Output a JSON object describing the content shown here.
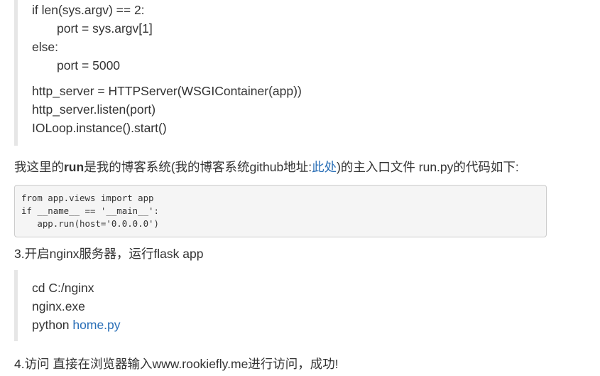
{
  "quote1": {
    "lines": [
      "if len(sys.argv) == 2:",
      "port = sys.argv[1]",
      "else:",
      "port = 5000",
      "http_server = HTTPServer(WSGIContainer(app))",
      "http_server.listen(port)",
      "IOLoop.instance().start()"
    ]
  },
  "para1": {
    "prefix": "我这里的",
    "bold": "run",
    "middle": "是我的博客系统(我的博客系统github地址:",
    "link": "此处",
    "suffix": ")的主入口文件 run.py的代码如下:"
  },
  "codeblock": {
    "lines": [
      "from app.views import app",
      "if __name__ == '__main__':",
      "   app.run(host='0.0.0.0')"
    ]
  },
  "step3": {
    "text": "3.开启nginx服务器，运行flask app"
  },
  "quote2": {
    "lines": [
      "cd C:/nginx",
      "nginx.exe"
    ],
    "python_prefix": "python ",
    "python_link": "home.py"
  },
  "step4": {
    "text": "4.访问 直接在浏览器输入www.rookiefly.me进行访问，成功!"
  },
  "colors": {
    "text": "#333333",
    "link": "#2a6fb7",
    "quote_border": "#e6e6e6",
    "code_bg": "#f5f5f5",
    "code_border": "#cccccc"
  }
}
